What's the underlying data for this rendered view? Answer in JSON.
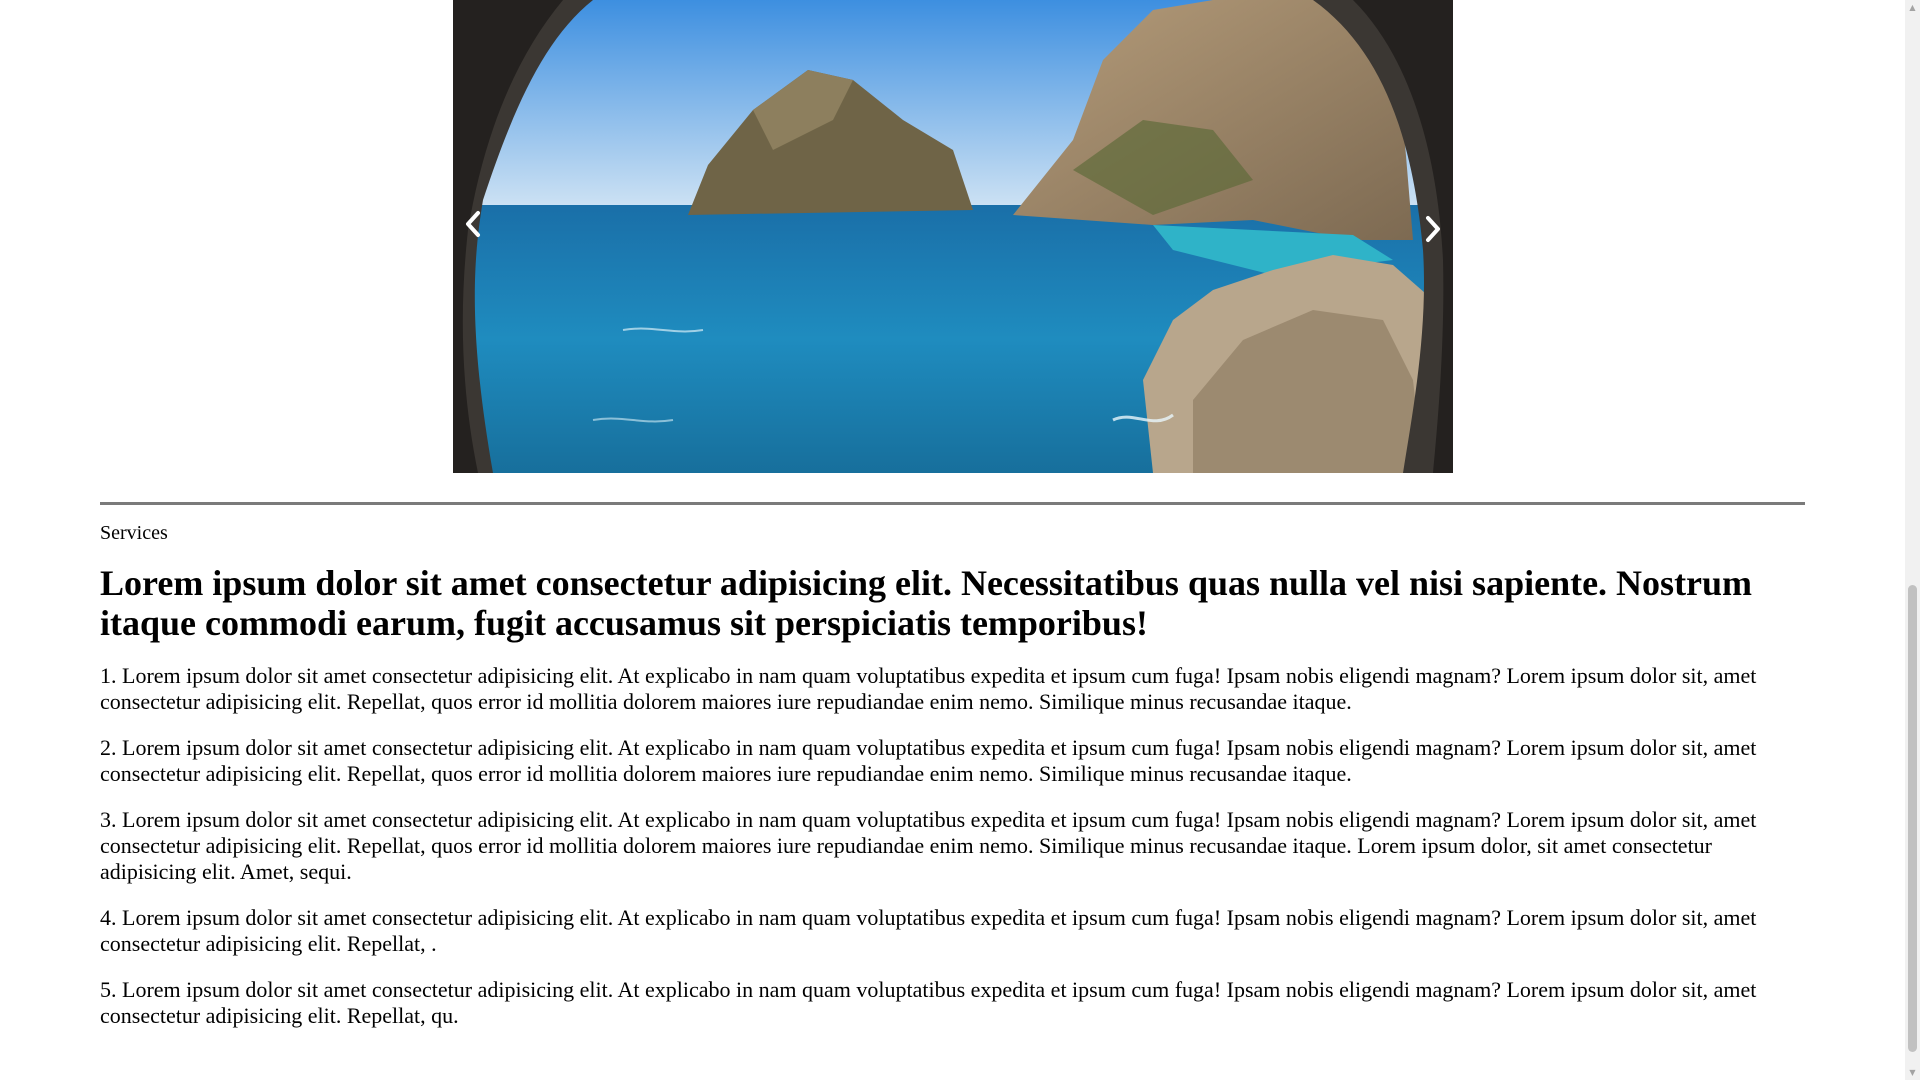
{
  "carousel": {
    "image_description_icon": "sea-cove-photo",
    "prev_icon": "chevron-left-icon",
    "next_icon": "chevron-right-icon"
  },
  "section": {
    "kicker": "Services",
    "headline": "Lorem ipsum dolor sit amet consectetur adipisicing elit. Necessitatibus quas nulla vel nisi sapiente. Nostrum itaque commodi earum, fugit accusamus sit perspiciatis temporibus!",
    "paragraphs": [
      "1. Lorem ipsum dolor sit amet consectetur adipisicing elit. At explicabo in nam quam voluptatibus expedita et ipsum cum fuga! Ipsam nobis eligendi magnam? Lorem ipsum dolor sit, amet consectetur adipisicing elit. Repellat, quos error id mollitia dolorem maiores iure repudiandae enim nemo. Similique minus recusandae itaque.",
      "2. Lorem ipsum dolor sit amet consectetur adipisicing elit. At explicabo in nam quam voluptatibus expedita et ipsum cum fuga! Ipsam nobis eligendi magnam? Lorem ipsum dolor sit, amet consectetur adipisicing elit. Repellat, quos error id mollitia dolorem maiores iure repudiandae enim nemo. Similique minus recusandae itaque.",
      "3. Lorem ipsum dolor sit amet consectetur adipisicing elit. At explicabo in nam quam voluptatibus expedita et ipsum cum fuga! Ipsam nobis eligendi magnam? Lorem ipsum dolor sit, amet consectetur adipisicing elit. Repellat, quos error id mollitia dolorem maiores iure repudiandae enim nemo. Similique minus recusandae itaque. Lorem ipsum dolor, sit amet consectetur adipisicing elit. Amet, sequi.",
      "4. Lorem ipsum dolor sit amet consectetur adipisicing elit. At explicabo in nam quam voluptatibus expedita et ipsum cum fuga! Ipsam nobis eligendi magnam? Lorem ipsum dolor sit, amet consectetur adipisicing elit. Repellat, .",
      "5. Lorem ipsum dolor sit amet consectetur adipisicing elit. At explicabo in nam quam voluptatibus expedita et ipsum cum fuga! Ipsam nobis eligendi magnam? Lorem ipsum dolor sit, amet consectetur adipisicing elit. Repellat, qu."
    ]
  },
  "colors": {
    "sea": "#1f86b3",
    "sky": "#7fb9e6",
    "rock": "#8a7a62",
    "divider": "#7a7a7a"
  }
}
